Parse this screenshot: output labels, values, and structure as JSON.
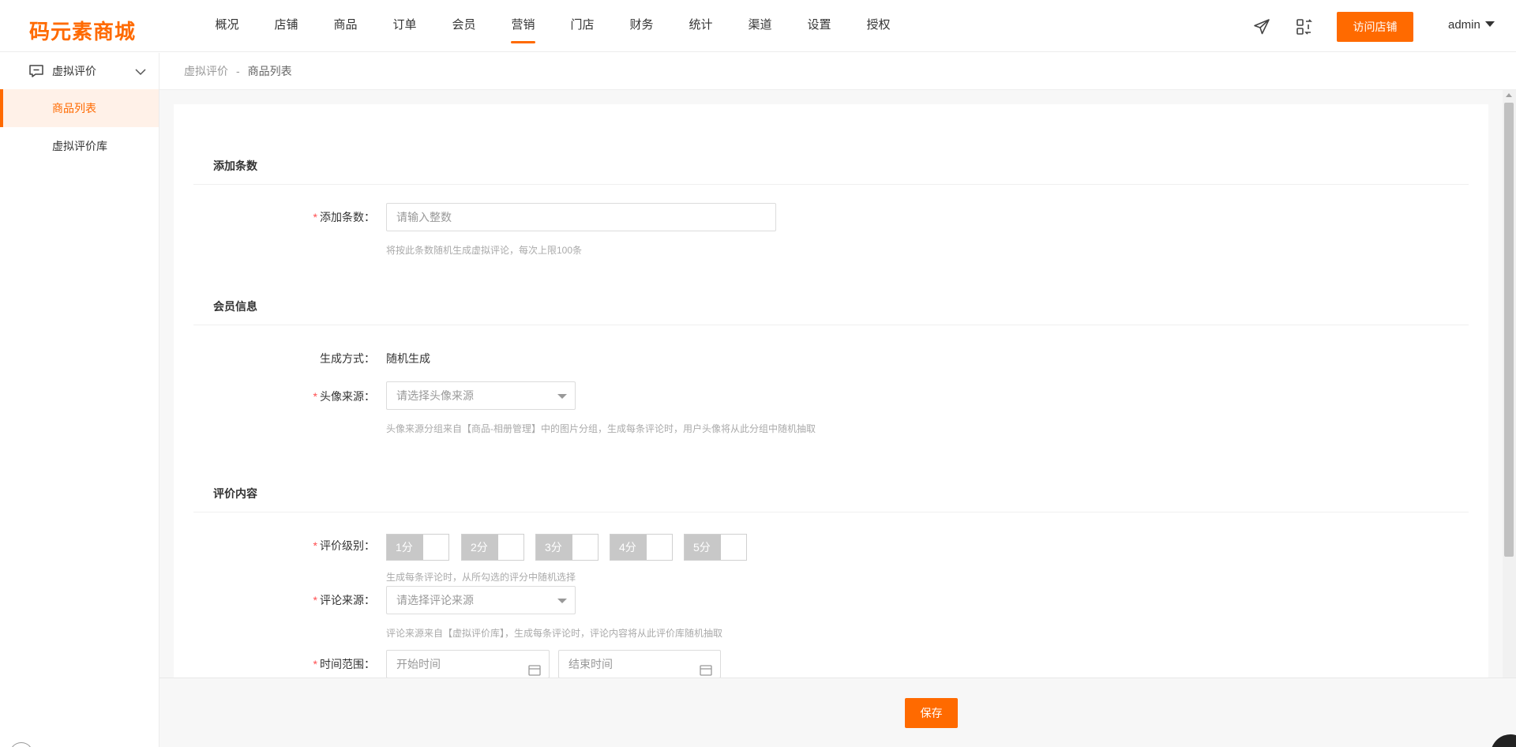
{
  "brand": {
    "logo": "码元素商城",
    "accent": "#ff6a00"
  },
  "nav": {
    "items": [
      "概况",
      "店铺",
      "商品",
      "订单",
      "会员",
      "营销",
      "门店",
      "财务",
      "统计",
      "渠道",
      "设置",
      "授权"
    ],
    "active": "营销"
  },
  "header": {
    "icons": [
      "send-icon",
      "switch-icon"
    ],
    "visit_label": "访问店铺",
    "user": "admin"
  },
  "sidebar": {
    "group_label": "虚拟评价",
    "items": [
      {
        "label": "商品列表",
        "active": true
      },
      {
        "label": "虚拟评价库",
        "active": false
      }
    ]
  },
  "breadcrumb": {
    "parent": "虚拟评价",
    "separator": "-",
    "current": "商品列表"
  },
  "form": {
    "section_add": {
      "title": "添加条数"
    },
    "count": {
      "label": "添加条数：",
      "placeholder": "请输入整数",
      "hint": "将按此条数随机生成虚拟评论，每次上限100条"
    },
    "section_member": {
      "title": "会员信息"
    },
    "gen_method": {
      "label": "生成方式：",
      "value": "随机生成"
    },
    "avatar_source": {
      "label": "头像来源：",
      "placeholder": "请选择头像来源",
      "hint": "头像来源分组来自【商品-相册管理】中的图片分组，生成每条评论时，用户头像将从此分组中随机抽取"
    },
    "section_content": {
      "title": "评价内容"
    },
    "rating": {
      "label": "评价级别：",
      "options": [
        "1分",
        "2分",
        "3分",
        "4分",
        "5分"
      ],
      "hint": "生成每条评论时，从所勾选的评分中随机选择"
    },
    "comment_source": {
      "label": "评论来源：",
      "placeholder": "请选择评论来源",
      "hint": "评论来源来自【虚拟评价库】，生成每条评论时，评论内容将从此评价库随机抽取"
    },
    "time_range": {
      "label": "时间范围：",
      "start_placeholder": "开始时间",
      "end_placeholder": "结束时间"
    }
  },
  "footer": {
    "save_label": "保存"
  }
}
